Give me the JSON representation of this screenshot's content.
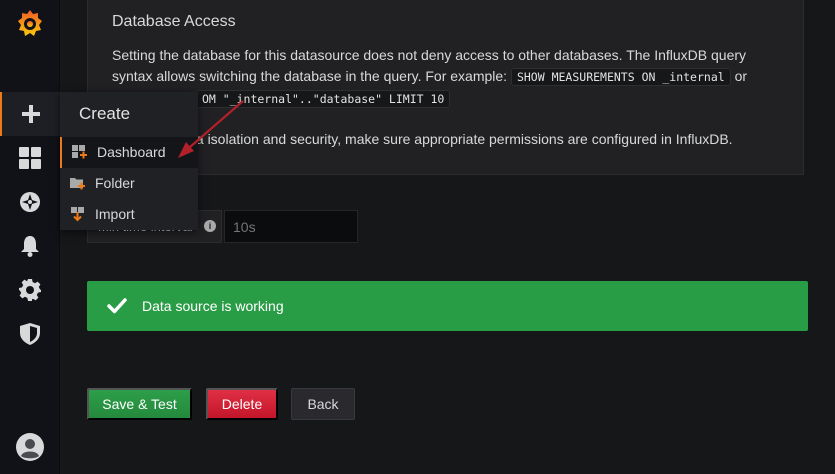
{
  "panel": {
    "title": "Database Access",
    "text_a": "Setting the database for this datasource does not deny access to other databases. The InfluxDB query syntax allows switching the database in the query. For example:",
    "code_a": "SHOW MEASUREMENTS ON _internal",
    "text_or": "or",
    "code_b_visible": "OM \"_internal\"..\"database\" LIMIT 10",
    "text_c_visible": "ta isolation and security, make sure appropriate permissions are configured in InfluxDB."
  },
  "interval": {
    "label_visible": "Min time interval",
    "value": "10s"
  },
  "status": {
    "message": "Data source is working",
    "color": "#299c46"
  },
  "buttons": {
    "save": "Save & Test",
    "delete": "Delete",
    "back": "Back"
  },
  "create_menu": {
    "header": "Create",
    "items": [
      {
        "label": "Dashboard",
        "icon": "dashboard-add-icon"
      },
      {
        "label": "Folder",
        "icon": "folder-add-icon"
      },
      {
        "label": "Import",
        "icon": "import-icon"
      }
    ]
  },
  "sidebar": {
    "icons": [
      "grafana-logo-icon",
      "plus-icon",
      "dashboards-grid-icon",
      "explore-compass-icon",
      "bell-icon",
      "gear-icon",
      "shield-icon",
      "user-avatar-icon"
    ]
  },
  "colors": {
    "accent": "#eb7b18",
    "delete": "#c4162a",
    "annotation_arrow": "#b3202a"
  }
}
